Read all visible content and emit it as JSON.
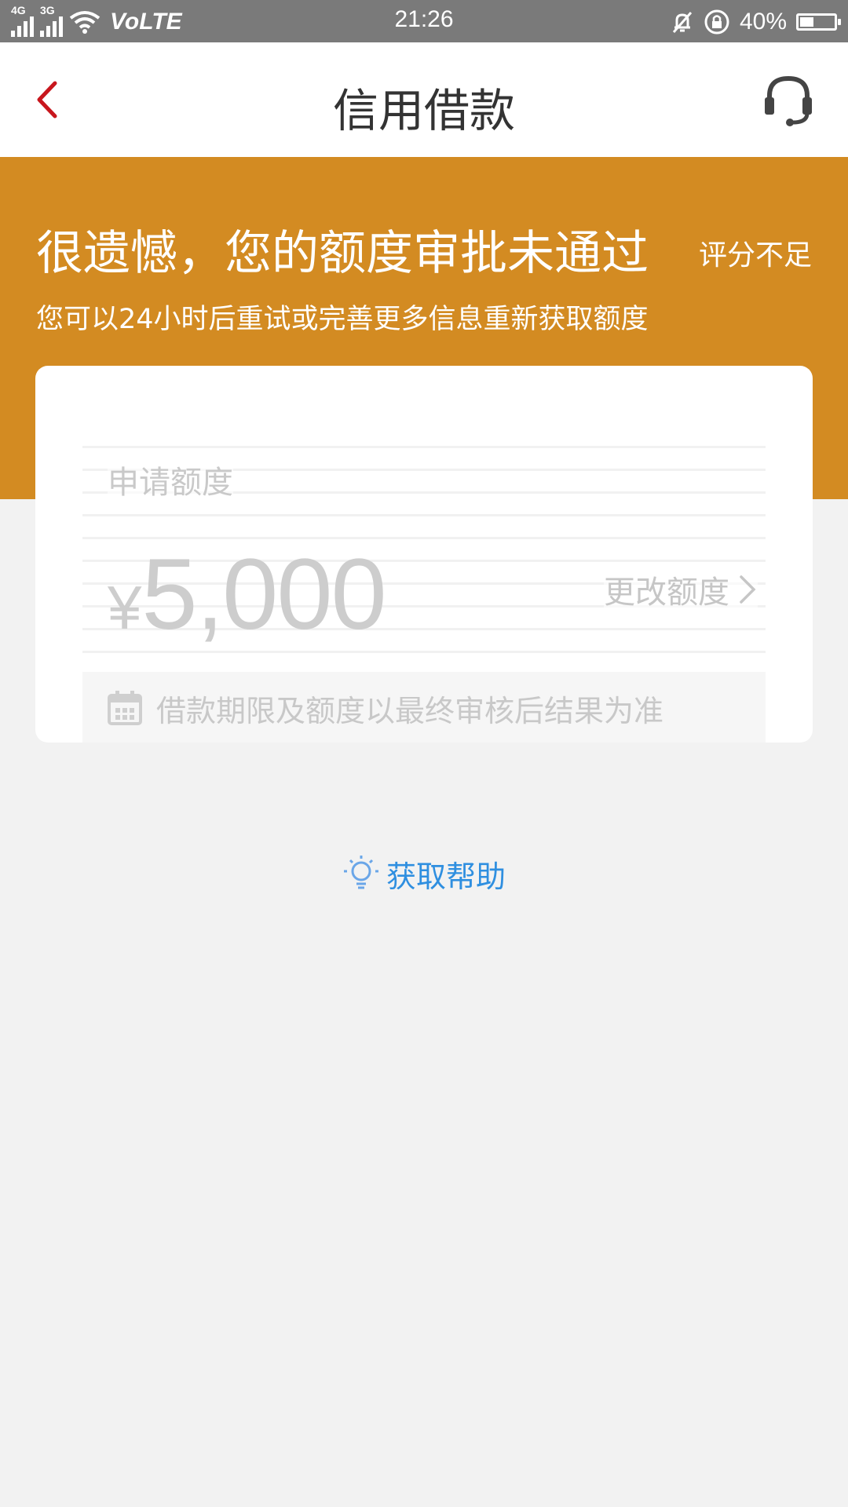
{
  "status_bar": {
    "network_1": "4G",
    "network_2": "3G",
    "volte": "VoLTE",
    "time": "21:26",
    "battery_percent": "40%",
    "battery_level": 0.4
  },
  "header": {
    "title": "信用借款",
    "back_icon": "back-arrow-icon",
    "support_icon": "headset-icon"
  },
  "banner": {
    "headline": "很遗憾，您的额度审批未通过",
    "tag": "评分不足",
    "subtitle": "您可以24小时后重试或完善更多信息重新获取额度"
  },
  "card": {
    "apply_label": "申请额度",
    "currency": "¥",
    "amount": "5,000",
    "change_label": "更改额度",
    "note": "借款期限及额度以最终审核后结果为准"
  },
  "help": {
    "label": "获取帮助",
    "icon": "lightbulb-icon"
  },
  "colors": {
    "banner": "#d38b22",
    "back_arrow": "#c8161d",
    "help_text": "#2f8fe0",
    "status_bar": "#7a7a7a"
  }
}
